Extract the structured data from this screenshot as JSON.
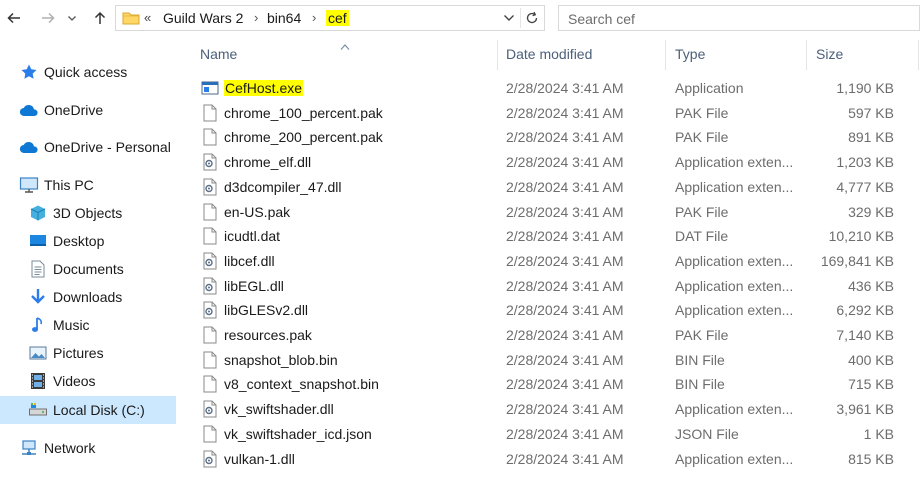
{
  "toolbar": {
    "back_icon": "back-arrow-icon",
    "forward_icon": "forward-arrow-icon",
    "history_icon": "chevron-down-icon",
    "up_icon": "up-arrow-icon"
  },
  "address": {
    "overflow": "«",
    "crumbs": [
      {
        "label": "Guild Wars 2"
      },
      {
        "label": "bin64"
      },
      {
        "label": "cef"
      }
    ],
    "separator": "›",
    "highlight_color": "#ffff00"
  },
  "search": {
    "placeholder": "Search cef"
  },
  "sidebar": {
    "items": [
      {
        "label": "Quick access",
        "icon": "star-icon"
      },
      {
        "label": "OneDrive",
        "icon": "cloud-icon"
      },
      {
        "label": "OneDrive - Personal",
        "icon": "cloud-icon"
      },
      {
        "label": "This PC",
        "icon": "computer-icon"
      },
      {
        "label": "3D Objects",
        "icon": "cube-icon"
      },
      {
        "label": "Desktop",
        "icon": "desktop-icon"
      },
      {
        "label": "Documents",
        "icon": "document-icon"
      },
      {
        "label": "Downloads",
        "icon": "download-icon"
      },
      {
        "label": "Music",
        "icon": "music-note-icon"
      },
      {
        "label": "Pictures",
        "icon": "picture-icon"
      },
      {
        "label": "Videos",
        "icon": "film-icon"
      },
      {
        "label": "Local Disk (C:)",
        "icon": "disk-icon",
        "selected": true
      },
      {
        "label": "Network",
        "icon": "network-icon"
      }
    ],
    "selected_color": "#cce8ff"
  },
  "columns": {
    "name": "Name",
    "date": "Date modified",
    "type": "Type",
    "size": "Size",
    "sorted_by": "Name"
  },
  "files": [
    {
      "name": "CefHost.exe",
      "date": "2/28/2024 3:41 AM",
      "type": "Application",
      "size": "1,190 KB",
      "icon": "application-icon",
      "highlighted": true
    },
    {
      "name": "chrome_100_percent.pak",
      "date": "2/28/2024 3:41 AM",
      "type": "PAK File",
      "size": "597 KB",
      "icon": "file-icon"
    },
    {
      "name": "chrome_200_percent.pak",
      "date": "2/28/2024 3:41 AM",
      "type": "PAK File",
      "size": "891 KB",
      "icon": "file-icon"
    },
    {
      "name": "chrome_elf.dll",
      "date": "2/28/2024 3:41 AM",
      "type": "Application exten...",
      "size": "1,203 KB",
      "icon": "dll-gear-icon"
    },
    {
      "name": "d3dcompiler_47.dll",
      "date": "2/28/2024 3:41 AM",
      "type": "Application exten...",
      "size": "4,777 KB",
      "icon": "dll-gear-icon"
    },
    {
      "name": "en-US.pak",
      "date": "2/28/2024 3:41 AM",
      "type": "PAK File",
      "size": "329 KB",
      "icon": "file-icon"
    },
    {
      "name": "icudtl.dat",
      "date": "2/28/2024 3:41 AM",
      "type": "DAT File",
      "size": "10,210 KB",
      "icon": "file-icon"
    },
    {
      "name": "libcef.dll",
      "date": "2/28/2024 3:41 AM",
      "type": "Application exten...",
      "size": "169,841 KB",
      "icon": "dll-gear-icon"
    },
    {
      "name": "libEGL.dll",
      "date": "2/28/2024 3:41 AM",
      "type": "Application exten...",
      "size": "436 KB",
      "icon": "dll-gear-icon"
    },
    {
      "name": "libGLESv2.dll",
      "date": "2/28/2024 3:41 AM",
      "type": "Application exten...",
      "size": "6,292 KB",
      "icon": "dll-gear-icon"
    },
    {
      "name": "resources.pak",
      "date": "2/28/2024 3:41 AM",
      "type": "PAK File",
      "size": "7,140 KB",
      "icon": "file-icon"
    },
    {
      "name": "snapshot_blob.bin",
      "date": "2/28/2024 3:41 AM",
      "type": "BIN File",
      "size": "400 KB",
      "icon": "file-icon"
    },
    {
      "name": "v8_context_snapshot.bin",
      "date": "2/28/2024 3:41 AM",
      "type": "BIN File",
      "size": "715 KB",
      "icon": "file-icon"
    },
    {
      "name": "vk_swiftshader.dll",
      "date": "2/28/2024 3:41 AM",
      "type": "Application exten...",
      "size": "3,961 KB",
      "icon": "dll-gear-icon"
    },
    {
      "name": "vk_swiftshader_icd.json",
      "date": "2/28/2024 3:41 AM",
      "type": "JSON File",
      "size": "1 KB",
      "icon": "file-icon"
    },
    {
      "name": "vulkan-1.dll",
      "date": "2/28/2024 3:41 AM",
      "type": "Application exten...",
      "size": "815 KB",
      "icon": "dll-gear-icon"
    }
  ]
}
